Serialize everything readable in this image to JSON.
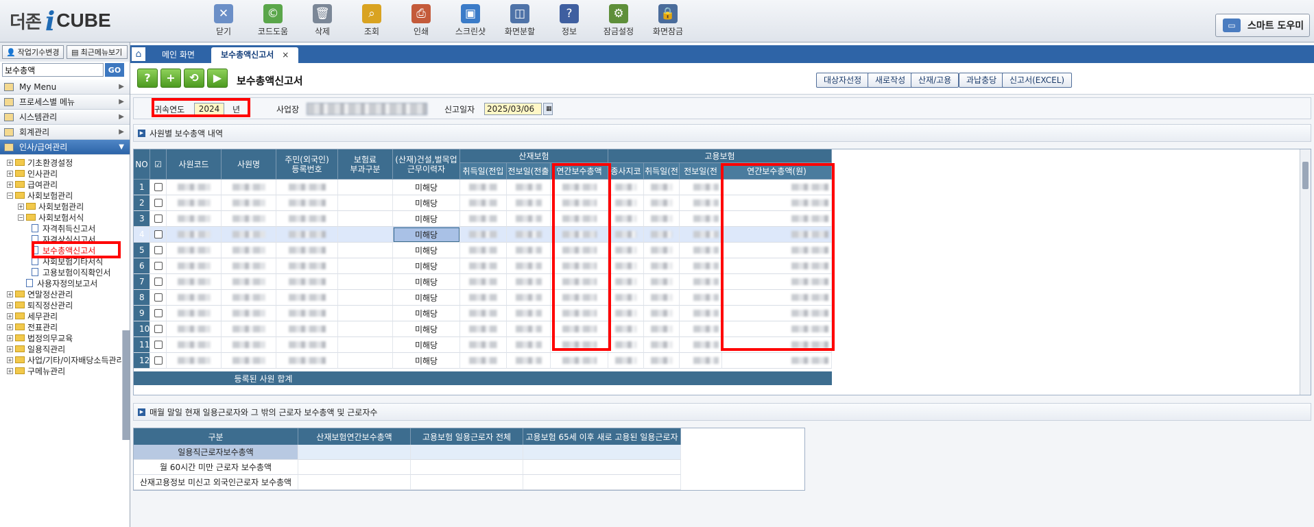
{
  "app": {
    "logo_ko": "더존",
    "logo_i": "i",
    "logo_cube": "CUBE"
  },
  "toolbar": [
    {
      "label": "닫기",
      "icon": "close-window-icon",
      "color": "#6b8fc7",
      "glyph": "✕"
    },
    {
      "label": "코드도움",
      "icon": "code-help-icon",
      "color": "#5aa64a",
      "glyph": "©"
    },
    {
      "label": "삭제",
      "icon": "trash-icon",
      "color": "#7b8797",
      "glyph": "🗑"
    },
    {
      "label": "조회",
      "icon": "search-icon",
      "color": "#d9a321",
      "glyph": "⌕"
    },
    {
      "label": "인쇄",
      "icon": "printer-icon",
      "color": "#c45a3a",
      "glyph": "⎙"
    },
    {
      "label": "스크린샷",
      "icon": "screenshot-icon",
      "color": "#3a7bc8",
      "glyph": "▣"
    },
    {
      "label": "화면분할",
      "icon": "split-screen-icon",
      "color": "#4f73a8",
      "glyph": "◫"
    },
    {
      "label": "정보",
      "icon": "info-icon",
      "color": "#3f5fa0",
      "glyph": "?"
    },
    {
      "label": "잠금설정",
      "icon": "lock-settings-icon",
      "color": "#5e8f3a",
      "glyph": "⚙"
    },
    {
      "label": "화면잠금",
      "icon": "screen-lock-icon",
      "color": "#4a6c9b",
      "glyph": "🔒"
    }
  ],
  "smart_helper": "스마트 도우미",
  "sidebar": {
    "btn_change_company": "작업기수변경",
    "btn_recent": "최근메뉴보기",
    "search_value": "보수총액",
    "go": "GO",
    "menus": [
      "My Menu",
      "프로세스별 메뉴",
      "시스템관리",
      "회계관리",
      "인사/급여관리"
    ],
    "tree": [
      {
        "label": "기초환경설정",
        "level": 1,
        "type": "folder",
        "pm": "+"
      },
      {
        "label": "인사관리",
        "level": 1,
        "type": "folder",
        "pm": "+"
      },
      {
        "label": "급여관리",
        "level": 1,
        "type": "folder",
        "pm": "+"
      },
      {
        "label": "사회보험관리",
        "level": 1,
        "type": "folder",
        "pm": "−"
      },
      {
        "label": "사회보험관리",
        "level": 2,
        "type": "folder",
        "pm": "+"
      },
      {
        "label": "사회보험서식",
        "level": 2,
        "type": "folder",
        "pm": "−"
      },
      {
        "label": "자격취득신고서",
        "level": 3,
        "type": "doc"
      },
      {
        "label": "자격상실신고서",
        "level": 3,
        "type": "doc"
      },
      {
        "label": "보수총액신고서",
        "level": 3,
        "type": "doc",
        "selected": true
      },
      {
        "label": "사회보험기타서식",
        "level": 3,
        "type": "doc"
      },
      {
        "label": "고용보험이직확인서",
        "level": 3,
        "type": "doc"
      },
      {
        "label": "사용자정의보고서",
        "level": 2,
        "type": "doc"
      },
      {
        "label": "연말정산관리",
        "level": 1,
        "type": "folder",
        "pm": "+"
      },
      {
        "label": "퇴직정산관리",
        "level": 1,
        "type": "folder",
        "pm": "+"
      },
      {
        "label": "세무관리",
        "level": 1,
        "type": "folder",
        "pm": "+"
      },
      {
        "label": "전표관리",
        "level": 1,
        "type": "folder",
        "pm": "+"
      },
      {
        "label": "법정의무교육",
        "level": 1,
        "type": "folder",
        "pm": "+"
      },
      {
        "label": "일용직관리",
        "level": 1,
        "type": "folder",
        "pm": "+"
      },
      {
        "label": "사업/기타/이자배당소득관리",
        "level": 1,
        "type": "folder",
        "pm": "+"
      },
      {
        "label": "구메뉴관리",
        "level": 1,
        "type": "folder",
        "pm": "+"
      }
    ]
  },
  "tabs": {
    "main": "메인 화면",
    "active": "보수총액신고서",
    "close": "×"
  },
  "page": {
    "title": "보수총액신고서",
    "right_buttons": [
      "대상자선정",
      "새로작성",
      "산재/고용",
      "과납충당",
      "신고서(EXCEL)"
    ]
  },
  "filters": {
    "year_label": "귀속연도",
    "year_value": "2024",
    "year_unit": "년",
    "site_label": "사업장",
    "date_label": "신고일자",
    "date_value": "2025/03/06"
  },
  "section1": "사원별 보수총액 내역",
  "grid": {
    "headers": [
      "NO",
      "사원코드",
      "사원명",
      "주민(외국인)\n등록번호",
      "보험료\n부과구분",
      "(산재)건설,벌목업\n근무이력자"
    ],
    "group_sanjae": "산재보험",
    "group_goyong": "고용보험",
    "sub_sanjae": [
      "취득일(전입",
      "전보일(전출",
      "연간보수총액"
    ],
    "sub_goyong": [
      "종사지코",
      "취득일(전",
      "전보일(전",
      "연간보수총액(원)"
    ],
    "rows": [
      "1",
      "2",
      "3",
      "4",
      "5",
      "6",
      "7",
      "8",
      "9",
      "10",
      "11",
      "12"
    ],
    "construction_value": "미해당",
    "selected_row": 3,
    "total_label": "등록된 사원 합계"
  },
  "section2": "매월 말일 현재 일용근로자와 그 밖의 근로자 보수총액 및 근로자수",
  "bottom_table": {
    "headers": [
      "구분",
      "산재보험연간보수총액",
      "고용보험 일용근로자 전체",
      "고용보험 65세 이후 새로 고용된 일용근로자"
    ],
    "rows": [
      "일용직근로자보수총액",
      "월 60시간 미만 근로자 보수총액",
      "산재고용정보 미신고 외국인근로자 보수총액"
    ]
  },
  "colors": {
    "accent": "#2e64a7",
    "header": "#3d6d8f",
    "highlight": "#ff0000"
  }
}
